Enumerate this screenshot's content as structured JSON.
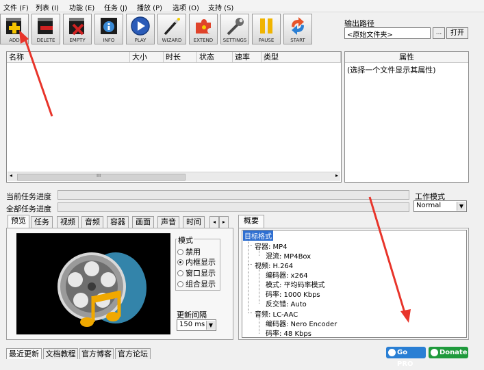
{
  "menu": [
    "文件 (F)",
    "列表 (I)",
    "功能 (E)",
    "任务 (J)",
    "播放 (P)",
    "选项 (O)",
    "支持 (S)"
  ],
  "toolbar": {
    "add": "ADD",
    "delete": "DELETE",
    "empty": "EMPTY",
    "info": "INFO",
    "play": "PLAY",
    "wizard": "WIZARD",
    "extend": "EXTEND",
    "settings": "SETTINGS",
    "pause": "PAUSE",
    "start": "START"
  },
  "output": {
    "label": "输出路径",
    "value": "<原始文件夹>",
    "browse": "...",
    "open": "打开"
  },
  "filelist": {
    "columns": [
      "名称",
      "大小",
      "时长",
      "状态",
      "速率",
      "类型"
    ],
    "scroll_marker": "III"
  },
  "properties": {
    "header": "属性",
    "hint": "(选择一个文件显示其属性)"
  },
  "progress": {
    "current_label": "当前任务进度",
    "total_label": "全部任务进度",
    "current": 0,
    "total": 0
  },
  "workmode": {
    "label": "工作模式",
    "value": "Normal"
  },
  "left_tabs": [
    "预览",
    "任务",
    "视频",
    "音频",
    "容器",
    "画面",
    "声音",
    "时间"
  ],
  "mode": {
    "title": "模式",
    "options": [
      "禁用",
      "内框显示",
      "窗口显示",
      "组合显示"
    ],
    "selected": "内框显示",
    "interval_label": "更新间隔",
    "interval_value": "150 ms"
  },
  "overview": {
    "tab": "概要",
    "root": "目标格式",
    "container": "容器: MP4",
    "muxer": "混流: MP4Box",
    "video": "视频: H.264",
    "v_encoder": "编码器: x264",
    "v_mode": "模式: 平均码率模式",
    "v_bitrate": "码率: 1000 Kbps",
    "deinterlace": "反交错: Auto",
    "audio": "音频: LC-AAC",
    "a_encoder": "编码器: Nero Encoder",
    "a_bitrate": "码率: 48 Kbps"
  },
  "footer": {
    "tabs": [
      "最近更新",
      "文档教程",
      "官方博客",
      "官方论坛"
    ],
    "gopro": "Go PRO",
    "donate": "Donate"
  },
  "colors": {
    "tree_highlight": "#2f6fd1",
    "annotation": "#e8342a",
    "gopro": "#2a7fd4",
    "donate": "#1f9a3c"
  }
}
